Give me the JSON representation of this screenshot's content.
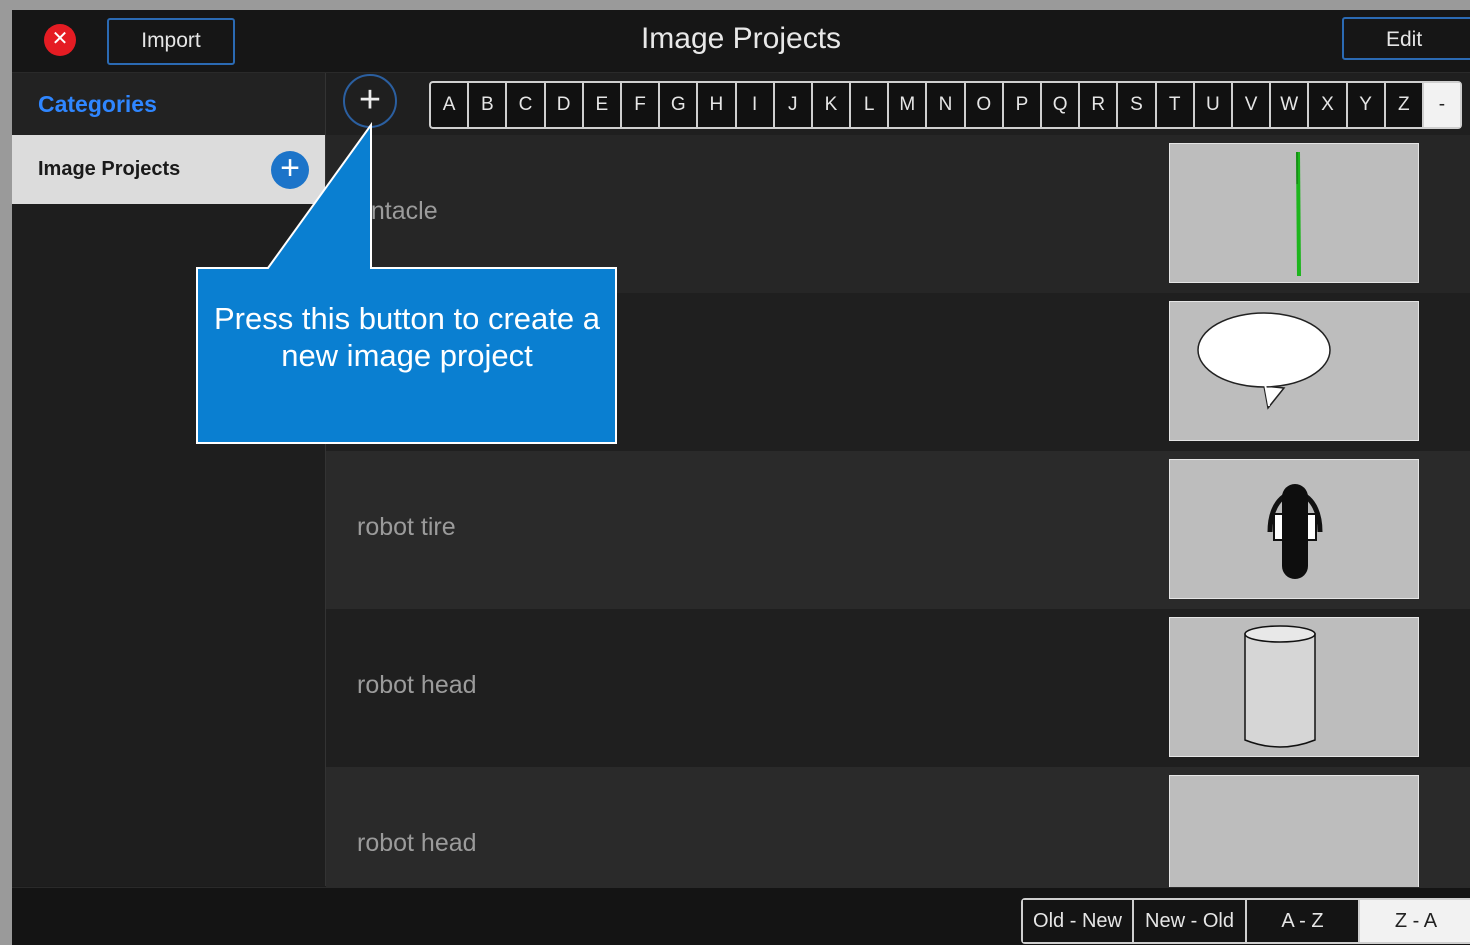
{
  "window": {
    "title": "Image Projects"
  },
  "toolbar": {
    "close_icon": "close-icon",
    "import_label": "Import",
    "edit_label": "Edit"
  },
  "sidebar": {
    "header": "Categories",
    "items": [
      {
        "label": "Image Projects",
        "icon": "plus-icon"
      }
    ]
  },
  "index_bar": {
    "add_icon": "plus-icon",
    "letters": [
      "A",
      "B",
      "C",
      "D",
      "E",
      "F",
      "G",
      "H",
      "I",
      "J",
      "K",
      "L",
      "M",
      "N",
      "O",
      "P",
      "Q",
      "R",
      "S",
      "T",
      "U",
      "V",
      "W",
      "X",
      "Y",
      "Z",
      "-"
    ]
  },
  "projects": [
    {
      "name": "entacle",
      "thumbnail": "tentacle-thumbnail"
    },
    {
      "name": "",
      "thumbnail": "speech-bubble-thumbnail"
    },
    {
      "name": "robot tire",
      "thumbnail": "tire-thumbnail"
    },
    {
      "name": "robot head",
      "thumbnail": "cylinder-thumbnail"
    },
    {
      "name": "robot head",
      "thumbnail": "blank-thumbnail"
    }
  ],
  "sort_options": [
    "Old - New",
    "New - Old",
    "A - Z",
    "Z - A"
  ],
  "sort_selected": "Z - A",
  "callout": {
    "text": "Press this button to create a new image project"
  },
  "colors": {
    "accent": "#2f86ff",
    "callout": "#0a7fd1",
    "close": "#e51c23"
  }
}
